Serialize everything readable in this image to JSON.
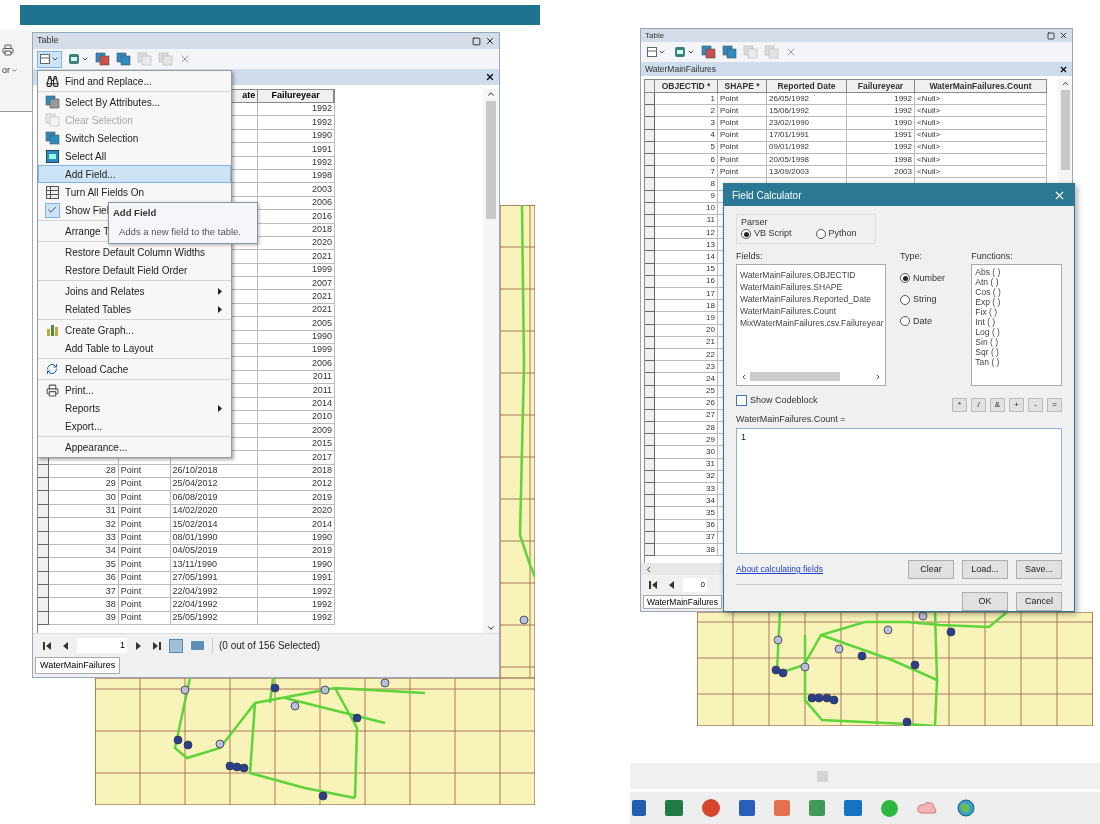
{
  "left": {
    "edge_label": "or",
    "table_window": {
      "title": "Table",
      "columns": [
        {
          "label": "ate"
        },
        {
          "label": "Failureyear"
        }
      ],
      "rows": [
        {
          "year": "1992"
        },
        {
          "year": "1992"
        },
        {
          "year": "1990"
        },
        {
          "year": "1991"
        },
        {
          "year": "1992"
        },
        {
          "year": "1998"
        },
        {
          "year": "2003"
        },
        {
          "year": "2006"
        },
        {
          "year": "2016"
        },
        {
          "year": "2018"
        },
        {
          "year": "2020"
        },
        {
          "year": "2021"
        },
        {
          "year": "1999"
        },
        {
          "year": "2007"
        },
        {
          "year": "2021"
        },
        {
          "year": "2021"
        },
        {
          "year": "2005"
        },
        {
          "year": "1990"
        },
        {
          "year": "1999"
        },
        {
          "year": "2006"
        },
        {
          "year": "2011"
        },
        {
          "year": "2011"
        },
        {
          "year": "2014"
        },
        {
          "year": "2010"
        },
        {
          "year": "2009"
        },
        {
          "year": "2015"
        },
        {
          "year": "2017"
        },
        {
          "objectid": "28",
          "shape": "Point",
          "date": "26/10/2018",
          "year": "2018"
        },
        {
          "objectid": "29",
          "shape": "Point",
          "date": "25/04/2012",
          "year": "2012"
        },
        {
          "objectid": "30",
          "shape": "Point",
          "date": "06/08/2019",
          "year": "2019"
        },
        {
          "objectid": "31",
          "shape": "Point",
          "date": "14/02/2020",
          "year": "2020"
        },
        {
          "objectid": "32",
          "shape": "Point",
          "date": "15/02/2014",
          "year": "2014"
        },
        {
          "objectid": "33",
          "shape": "Point",
          "date": "08/01/1990",
          "year": "1990"
        },
        {
          "objectid": "34",
          "shape": "Point",
          "date": "04/05/2019",
          "year": "2019"
        },
        {
          "objectid": "35",
          "shape": "Point",
          "date": "13/11/1990",
          "year": "1990"
        },
        {
          "objectid": "36",
          "shape": "Point",
          "date": "27/05/1991",
          "year": "1991"
        },
        {
          "objectid": "37",
          "shape": "Point",
          "date": "22/04/1992",
          "year": "1992"
        },
        {
          "objectid": "38",
          "shape": "Point",
          "date": "22/04/1992",
          "year": "1992"
        },
        {
          "objectid": "39",
          "shape": "Point",
          "date": "25/05/1992",
          "year": "1992"
        }
      ],
      "page": "1",
      "selection_status": "(0 out of 156 Selected)",
      "tab": {
        "label": "WaterMainFailures",
        "selected": true
      }
    },
    "menu": {
      "groups": [
        [
          {
            "label": "Find and Replace...",
            "selected": false,
            "disabled": false,
            "checked": false,
            "submenu": false
          }
        ],
        [
          {
            "label": "Select By Attributes...",
            "selected": false,
            "disabled": false,
            "checked": false,
            "submenu": false
          },
          {
            "label": "Clear Selection",
            "selected": false,
            "disabled": true,
            "checked": false,
            "submenu": false
          },
          {
            "label": "Switch Selection",
            "selected": false,
            "disabled": false,
            "checked": false,
            "submenu": false
          },
          {
            "label": "Select All",
            "selected": false,
            "disabled": false,
            "checked": false,
            "submenu": false
          },
          {
            "label": "Add Field...",
            "selected": true,
            "disabled": false,
            "checked": false,
            "submenu": false
          },
          {
            "label": "Turn All Fields On",
            "selected": false,
            "disabled": false,
            "checked": false,
            "submenu": false
          },
          {
            "label": "Show Fiel",
            "selected": false,
            "disabled": false,
            "checked": true,
            "submenu": false
          }
        ],
        [
          {
            "label": "Arrange T",
            "selected": false,
            "disabled": false,
            "checked": false
          }
        ],
        [
          {
            "label": "Restore Default Column Widths",
            "selected": false,
            "disabled": false,
            "checked": false,
            "submenu": false
          },
          {
            "label": "Restore Default Field Order",
            "selected": false,
            "disabled": false,
            "checked": false,
            "submenu": false
          }
        ],
        [
          {
            "label": "Joins and Relates",
            "selected": false,
            "disabled": false,
            "checked": false,
            "submenu": true
          },
          {
            "label": "Related Tables",
            "selected": false,
            "disabled": false,
            "checked": false,
            "submenu": true
          }
        ],
        [
          {
            "label": "Create Graph...",
            "selected": false,
            "disabled": false,
            "checked": false,
            "submenu": false
          },
          {
            "label": "Add Table to Layout",
            "selected": false,
            "disabled": false,
            "checked": false,
            "submenu": false
          }
        ],
        [
          {
            "label": "Reload Cache",
            "selected": false,
            "disabled": false,
            "checked": false,
            "submenu": false
          }
        ],
        [
          {
            "label": "Print...",
            "selected": false,
            "disabled": false,
            "checked": false,
            "submenu": false
          },
          {
            "label": "Reports",
            "selected": false,
            "disabled": false,
            "checked": false,
            "submenu": true
          },
          {
            "label": "Export...",
            "selected": false,
            "disabled": false,
            "checked": false,
            "submenu": false
          }
        ],
        [
          {
            "label": "Appearance...",
            "selected": false,
            "disabled": false,
            "checked": false,
            "submenu": false
          }
        ]
      ]
    },
    "tooltip": {
      "title": "Add Field",
      "text": "Adds a new field to the table."
    }
  },
  "right": {
    "table_window": {
      "title": "Table",
      "tab_title": "WaterMainFailures",
      "columns": [
        {
          "label": "OBJECTID *"
        },
        {
          "label": "SHAPE *"
        },
        {
          "label": "Reported Date"
        },
        {
          "label": "Failureyear"
        },
        {
          "label": "WaterMainFailures.Count"
        }
      ],
      "rows": [
        {
          "objectid": "1",
          "shape": "Point",
          "date": "26/05/1992",
          "year": "1992",
          "count": "<Null>"
        },
        {
          "objectid": "2",
          "shape": "Point",
          "date": "15/06/1992",
          "year": "1992",
          "count": "<Null>"
        },
        {
          "objectid": "3",
          "shape": "Point",
          "date": "23/02/1990",
          "year": "1990",
          "count": "<Null>"
        },
        {
          "objectid": "4",
          "shape": "Point",
          "date": "17/01/1991",
          "year": "1991",
          "count": "<Null>"
        },
        {
          "objectid": "5",
          "shape": "Point",
          "date": "09/01/1992",
          "year": "1992",
          "count": "<Null>"
        },
        {
          "objectid": "6",
          "shape": "Point",
          "date": "20/05/1998",
          "year": "1998",
          "count": "<Null>"
        },
        {
          "objectid": "7",
          "shape": "Point",
          "date": "13/09/2003",
          "year": "2003",
          "count": "<Null>"
        },
        {
          "objectid": "8"
        },
        {
          "objectid": "9"
        },
        {
          "objectid": "10"
        },
        {
          "objectid": "11"
        },
        {
          "objectid": "12"
        },
        {
          "objectid": "13"
        },
        {
          "objectid": "14"
        },
        {
          "objectid": "15"
        },
        {
          "objectid": "16"
        },
        {
          "objectid": "17"
        },
        {
          "objectid": "18"
        },
        {
          "objectid": "19"
        },
        {
          "objectid": "20"
        },
        {
          "objectid": "21"
        },
        {
          "objectid": "22"
        },
        {
          "objectid": "23"
        },
        {
          "objectid": "24"
        },
        {
          "objectid": "25"
        },
        {
          "objectid": "26"
        },
        {
          "objectid": "27"
        },
        {
          "objectid": "28"
        },
        {
          "objectid": "29"
        },
        {
          "objectid": "30"
        },
        {
          "objectid": "31"
        },
        {
          "objectid": "32"
        },
        {
          "objectid": "33"
        },
        {
          "objectid": "34"
        },
        {
          "objectid": "35"
        },
        {
          "objectid": "36"
        },
        {
          "objectid": "37"
        },
        {
          "objectid": "38"
        }
      ],
      "page": "0",
      "tab": {
        "label": "WaterMainFailures",
        "selected": true
      }
    },
    "dialog": {
      "title": "Field Calculator",
      "parser": {
        "label": "Parser",
        "options": [
          {
            "label": "VB Script",
            "selected": true
          },
          {
            "label": "Python",
            "selected": false
          }
        ]
      },
      "fields": {
        "label": "Fields:",
        "items": [
          "WaterMainFailures.OBJECTID",
          "WaterMainFailures.SHAPE",
          "WaterMainFailures.Reported_Date",
          "WaterMainFailures.Count",
          "MixWaterMainFailures.csv.Failureyear"
        ]
      },
      "type": {
        "label": "Type:",
        "options": [
          {
            "label": "Number",
            "selected": true
          },
          {
            "label": "String",
            "selected": false
          },
          {
            "label": "Date",
            "selected": false
          }
        ]
      },
      "functions": {
        "label": "Functions:",
        "items": [
          "Abs ( )",
          "Atn ( )",
          "Cos ( )",
          "Exp ( )",
          "Fix ( )",
          "Int ( )",
          "Log ( )",
          "Sin ( )",
          "Sqr ( )",
          "Tan ( )"
        ]
      },
      "show_codeblock": {
        "label": "Show Codeblock",
        "checked": false
      },
      "operators": [
        "*",
        "/",
        "&",
        "+",
        "-",
        "="
      ],
      "expression_label": "WaterMainFailures.Count =",
      "expression": "1",
      "help_link": "About calculating fields",
      "buttons": [
        "Clear",
        "Load...",
        "Save..."
      ],
      "footer_buttons": [
        "OK",
        "Cancel"
      ]
    }
  }
}
